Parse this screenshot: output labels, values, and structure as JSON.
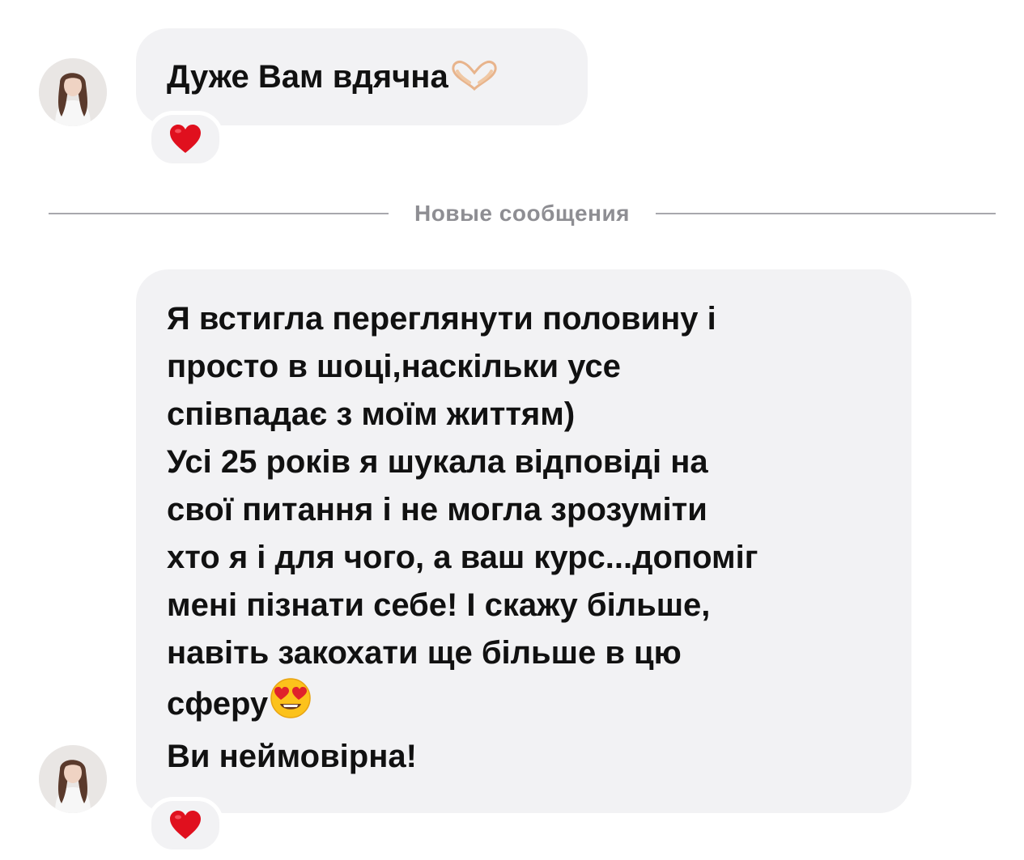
{
  "messages": [
    {
      "text": "Дуже Вам вдячна",
      "trailing_emoji": "heart-hands-icon",
      "reaction": "red-heart-icon"
    },
    {
      "lines": [
        "Я встигла переглянути половину і",
        "просто в шоці,наскільки усе",
        "співпадає з моїм життям)",
        "Усі 25 років я шукала відповіді на",
        "свої питання і не могла зрозуміти",
        "хто я і для чого, а ваш курс...допоміг",
        "мені пізнати себе! І скажу більше,",
        "навіть закохати ще більше в цю",
        "сферу",
        "Ви неймовірна!"
      ],
      "inline_emoji": "heart-eyes-icon",
      "reaction": "red-heart-icon"
    }
  ],
  "divider": {
    "label": "Новые сообщения"
  },
  "colors": {
    "bubble_background": "#f2f2f4",
    "divider_text": "#8e8e93",
    "divider_line": "#a8a8ad",
    "reaction_heart": "#e0101e"
  }
}
